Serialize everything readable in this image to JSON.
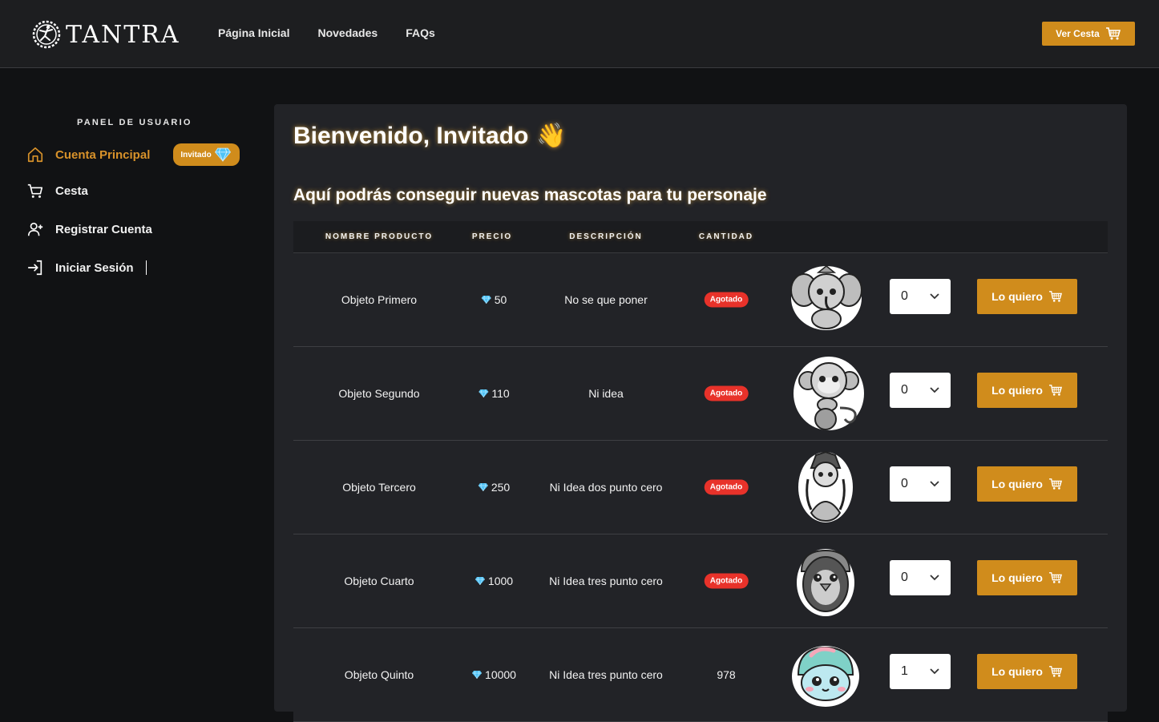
{
  "brand": {
    "name": "TANTRA"
  },
  "nav": {
    "links": [
      {
        "label": "Página Inicial"
      },
      {
        "label": "Novedades"
      },
      {
        "label": "FAQs"
      }
    ],
    "cart_label": "Ver Cesta"
  },
  "sidebar": {
    "title": "PANEL DE USUARIO",
    "items": [
      {
        "label": "Cuenta Principal",
        "icon": "home-icon",
        "active": true,
        "badge": "Invitado"
      },
      {
        "label": "Cesta",
        "icon": "cart-icon"
      },
      {
        "label": "Registrar Cuenta",
        "icon": "user-plus-icon"
      },
      {
        "label": "Iniciar Sesión",
        "icon": "login-icon"
      }
    ]
  },
  "main": {
    "welcome": "Bienvenido, Invitado",
    "welcome_emoji": "👋",
    "subtitle": "Aquí podrás conseguir nuevas mascotas para tu personaje",
    "table": {
      "headers": [
        "NOMBRE PRODUCTO",
        "PRECIO",
        "DESCRIPCIÓN",
        "CANTIDAD"
      ],
      "buy_label": "Lo quiero",
      "rows": [
        {
          "name": "Objeto Primero",
          "price": "50",
          "description": "No se que poner",
          "stock": "Agotado",
          "sold_out": true,
          "qty": "0",
          "pet": "elephant"
        },
        {
          "name": "Objeto Segundo",
          "price": "110",
          "description": "Ni idea",
          "stock": "Agotado",
          "sold_out": true,
          "qty": "0",
          "pet": "monkey"
        },
        {
          "name": "Objeto Tercero",
          "price": "250",
          "description": "Ni Idea dos punto cero",
          "stock": "Agotado",
          "sold_out": true,
          "qty": "0",
          "pet": "goddess"
        },
        {
          "name": "Objeto Cuarto",
          "price": "1000",
          "description": "Ni Idea tres punto cero",
          "stock": "Agotado",
          "sold_out": true,
          "qty": "0",
          "pet": "penguin"
        },
        {
          "name": "Objeto Quinto",
          "price": "10000",
          "description": "Ni Idea tres punto cero",
          "stock": "978",
          "sold_out": false,
          "qty": "1",
          "pet": "turtle"
        }
      ]
    }
  },
  "colors": {
    "accent": "#d08c1c",
    "danger": "#e8322a",
    "gem": "#4fc3f7"
  }
}
